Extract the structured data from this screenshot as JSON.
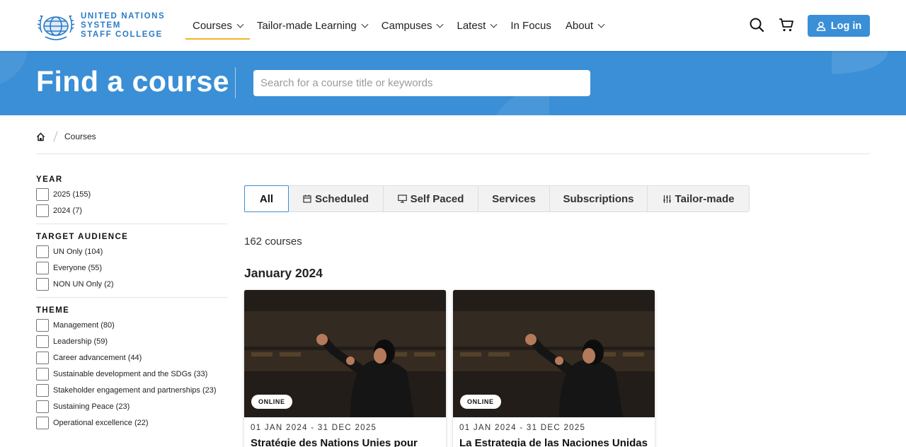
{
  "brand": {
    "line1": "UNITED NATIONS",
    "line2": "SYSTEM",
    "line3": "STAFF COLLEGE"
  },
  "nav": [
    {
      "label": "Courses",
      "dropdown": true,
      "active": true
    },
    {
      "label": "Tailor-made Learning",
      "dropdown": true
    },
    {
      "label": "Campuses",
      "dropdown": true
    },
    {
      "label": "Latest",
      "dropdown": true
    },
    {
      "label": "In Focus",
      "dropdown": false
    },
    {
      "label": "About",
      "dropdown": true
    }
  ],
  "header": {
    "login_label": "Log in"
  },
  "hero": {
    "title": "Find a course",
    "search_placeholder": "Search for a course title or keywords"
  },
  "breadcrumb": {
    "current": "Courses"
  },
  "filters": {
    "year": {
      "title": "YEAR",
      "options": [
        "2025 (155)",
        "2024 (7)"
      ]
    },
    "audience": {
      "title": "TARGET AUDIENCE",
      "options": [
        "UN Only (104)",
        "Everyone (55)",
        "NON UN Only (2)"
      ]
    },
    "theme": {
      "title": "THEME",
      "options": [
        "Management (80)",
        "Leadership (59)",
        "Career advancement (44)",
        "Sustainable development and the SDGs (33)",
        "Stakeholder engagement and partnerships (23)",
        "Sustaining Peace (23)",
        "Operational excellence (22)"
      ]
    }
  },
  "tabs": [
    {
      "label": "All",
      "icon": "",
      "active": true
    },
    {
      "label": "Scheduled",
      "icon": "calendar-icon"
    },
    {
      "label": "Self Paced",
      "icon": "monitor-icon"
    },
    {
      "label": "Services",
      "icon": ""
    },
    {
      "label": "Subscriptions",
      "icon": ""
    },
    {
      "label": "Tailor-made",
      "icon": "sliders-icon"
    }
  ],
  "results": {
    "count": "162 courses",
    "month": "January 2024"
  },
  "cards": [
    {
      "badge": "ONLINE",
      "date": "01 JAN 2024 - 31 DEC 2025",
      "title": "Stratégie des Nations Unies pour"
    },
    {
      "badge": "ONLINE",
      "date": "01 JAN 2024 - 31 DEC 2025",
      "title": "La Estrategia de las Naciones Unidas"
    }
  ],
  "colors": {
    "primary": "#3a8fd6",
    "accent": "#f0b429"
  }
}
